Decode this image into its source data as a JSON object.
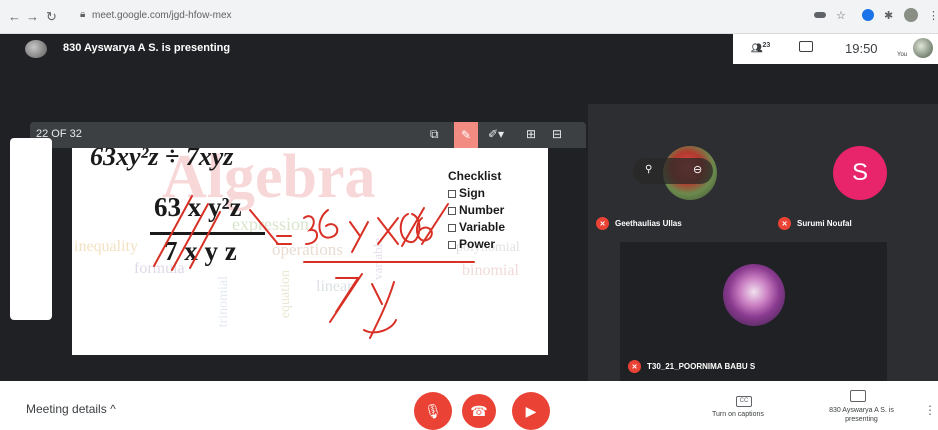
{
  "browser": {
    "url": "meet.google.com/jgd-hfow-mex",
    "back_icon": "arrow-left-icon",
    "forward_icon": "arrow-right-icon",
    "reload_icon": "reload-icon"
  },
  "presenter": {
    "label": "830 Ayswarya A S. is presenting"
  },
  "top_controls": {
    "people_count": "23",
    "time": "19:50",
    "you_label": "You"
  },
  "slide_toolbar": {
    "counter": "22 OF 32"
  },
  "slide": {
    "expression": "63xy²z ÷ 7xyz",
    "numerator": "63 x y²z",
    "denominator": "7 x y z",
    "watermark_title": "Algebra",
    "wordcloud": [
      "expression",
      "inequality",
      "operations",
      "formula",
      "linear",
      "polynomial",
      "binomial",
      "trinomial",
      "equation",
      "variable"
    ],
    "checklist_title": "Checklist",
    "checklist": [
      "Sign",
      "Number",
      "Variable",
      "Power"
    ]
  },
  "participants": [
    {
      "name": "Geethaulias Ullas"
    },
    {
      "name": "Surumi Noufal",
      "initial": "S"
    },
    {
      "name": "T30_21_POORNIMA BABU S"
    }
  ],
  "bottom": {
    "meeting_details": "Meeting details",
    "captions_icon_text": "CC",
    "captions_label": "Turn on captions",
    "present_label": "830 Ayswarya A S. is presenting"
  },
  "colors": {
    "danger": "#ea4335",
    "avatar_s": "#e8246a",
    "ink": "#d93025"
  }
}
